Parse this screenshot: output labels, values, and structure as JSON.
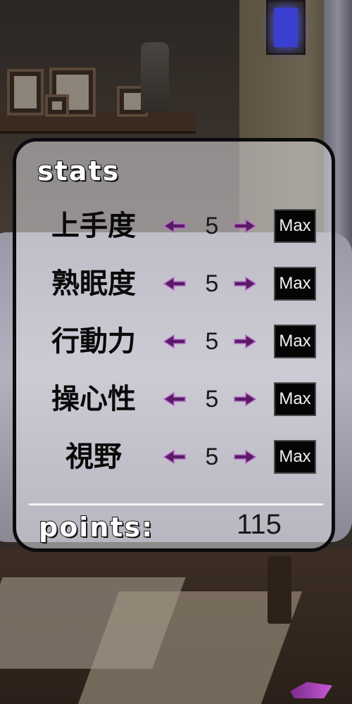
{
  "panel": {
    "title": "stats",
    "points_label": "points:",
    "points_value": "115"
  },
  "stats": [
    {
      "label": "上手度",
      "value": "5",
      "max_label": "Max"
    },
    {
      "label": "熟眠度",
      "value": "5",
      "max_label": "Max"
    },
    {
      "label": "行動力",
      "value": "5",
      "max_label": "Max"
    },
    {
      "label": "操心性",
      "value": "5",
      "max_label": "Max"
    },
    {
      "label": "視野",
      "value": "5",
      "max_label": "Max"
    }
  ],
  "icons": {
    "decrease": "arrow-left-icon",
    "increase": "arrow-right-icon"
  },
  "colors": {
    "arrow": "#5a1a66",
    "arrow_light": "#b86ac8",
    "max_button_bg": "#050505",
    "panel_border": "#0b0b0d"
  }
}
